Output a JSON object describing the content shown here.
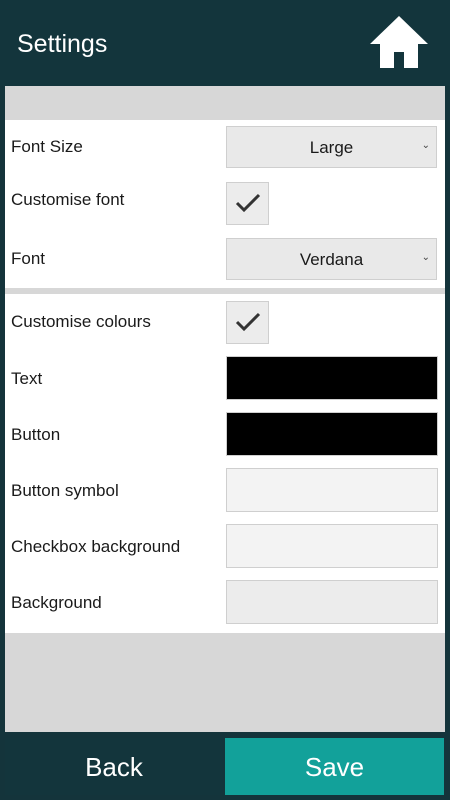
{
  "header": {
    "title": "Settings",
    "home_icon": "home-icon"
  },
  "font_section": {
    "font_size": {
      "label": "Font Size",
      "value": "Large"
    },
    "customise_font": {
      "label": "Customise font",
      "checked": true
    },
    "font": {
      "label": "Font",
      "value": "Verdana"
    }
  },
  "colour_section": {
    "customise_colours": {
      "label": "Customise colours",
      "checked": true
    },
    "text": {
      "label": "Text",
      "color": "#000000"
    },
    "button": {
      "label": "Button",
      "color": "#000000"
    },
    "button_symbol": {
      "label": "Button symbol",
      "color": "#f3f3f3"
    },
    "checkbox_background": {
      "label": "Checkbox background",
      "color": "#f3f3f3"
    },
    "background": {
      "label": "Background",
      "color": "#ececec"
    }
  },
  "footer": {
    "back_label": "Back",
    "save_label": "Save"
  },
  "colors": {
    "header_bg": "#13353c",
    "save_bg": "#12a19a",
    "panel_bg": "#d7d7d7"
  }
}
